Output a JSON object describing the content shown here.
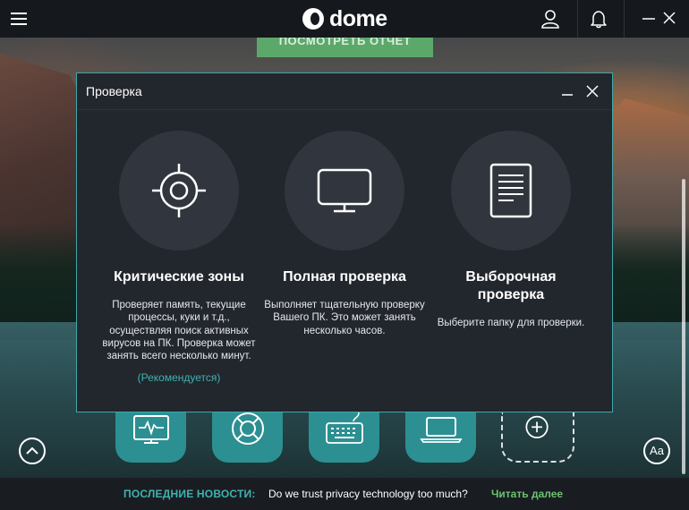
{
  "app": {
    "logo_text": "dome"
  },
  "background": {
    "report_button_label": "ПОСМОТРЕТЬ ОТЧЕТ"
  },
  "modal": {
    "title": "Проверка",
    "cards": [
      {
        "title": "Критические зоны",
        "description": "Проверяет память, текущие процессы, куки и т.д., осуществляя поиск активных вирусов на ПК. Проверка может занять всего несколько минут.",
        "note": "(Рекомендуется)",
        "icon": "crosshair-icon"
      },
      {
        "title": "Полная проверка",
        "description": "Выполняет тщательную проверку Вашего ПК. Это может занять несколько часов.",
        "icon": "monitor-icon"
      },
      {
        "title": "Выборочная проверка",
        "description": "Выберите папку для проверки.",
        "icon": "document-icon"
      }
    ]
  },
  "tiles": [
    {
      "icon": "monitor-pulse-icon"
    },
    {
      "icon": "lifebuoy-icon"
    },
    {
      "icon": "keyboard-icon"
    },
    {
      "icon": "laptop-icon"
    },
    {
      "icon": "plus-icon"
    }
  ],
  "font_button_label": "Aa",
  "news": {
    "label": "ПОСЛЕДНИЕ НОВОСТИ:",
    "headline": "Do we trust privacy technology too much?",
    "link": "Читать далее"
  },
  "colors": {
    "accent_teal": "#3fb3b0",
    "tile_teal": "#2c8f92",
    "link_green": "#6ec26f",
    "modal_bg": "#22262d"
  }
}
